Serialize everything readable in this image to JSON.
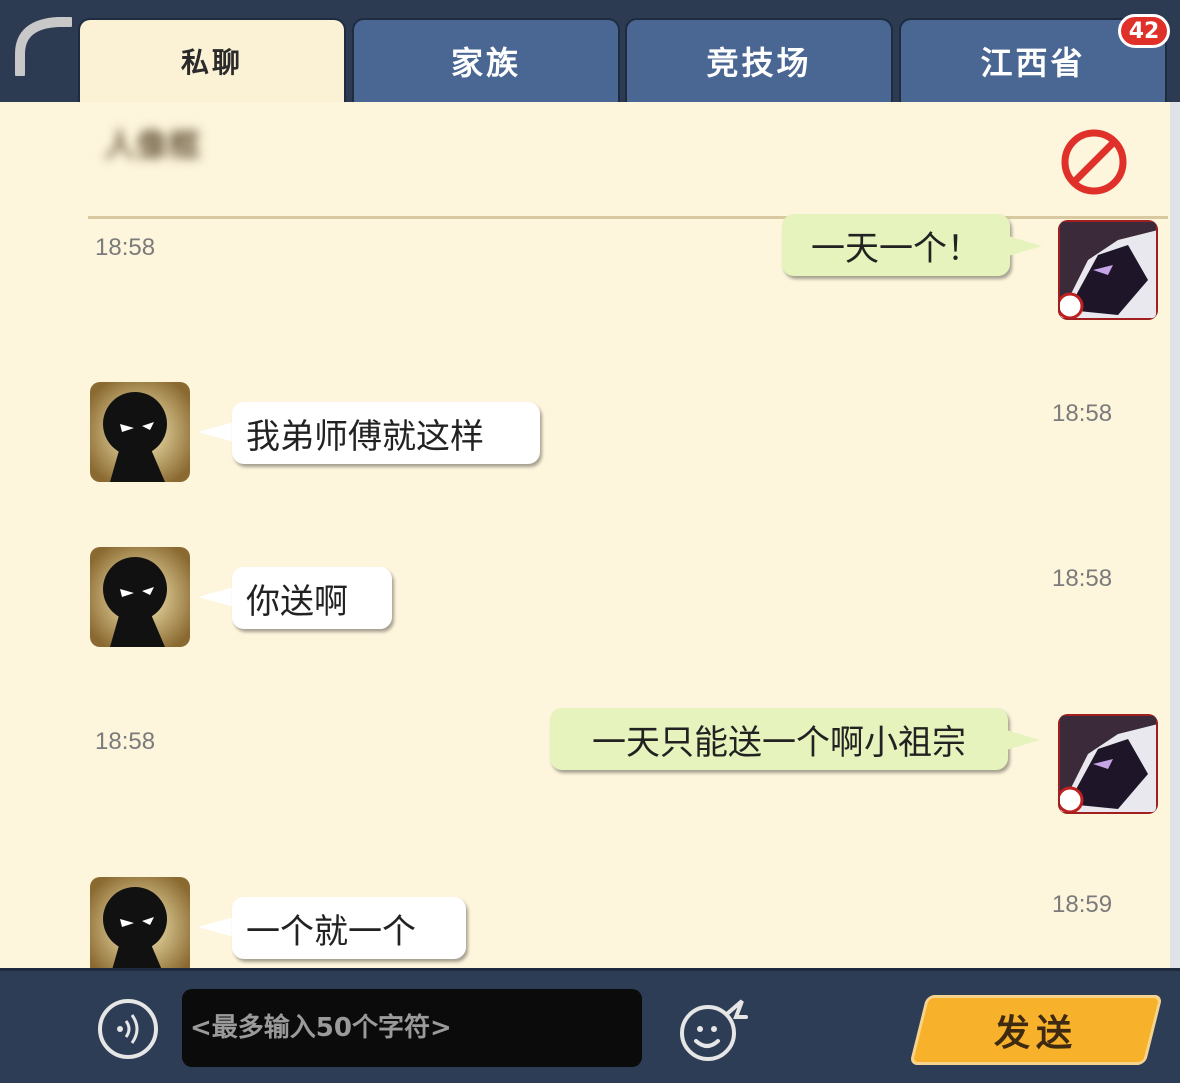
{
  "tabs": [
    {
      "label": "私聊"
    },
    {
      "label": "家族"
    },
    {
      "label": "竞技场"
    },
    {
      "label": "江西省"
    }
  ],
  "badge_count": "42",
  "header": {
    "contact_name": "人像框"
  },
  "messages": [
    {
      "side": "out",
      "text": "一天一个！",
      "time": "18:58"
    },
    {
      "side": "in",
      "text": "我弟师傅就这样",
      "time": "18:58"
    },
    {
      "side": "in",
      "text": "你送啊",
      "time": "18:58"
    },
    {
      "side": "out",
      "text": "一天只能送一个啊小祖宗",
      "time": "18:58"
    },
    {
      "side": "in",
      "text": "一个就一个",
      "time": "18:59"
    }
  ],
  "input": {
    "placeholder": "<最多输入50个字符>"
  },
  "send_button": {
    "label": "发送"
  },
  "icons": {
    "back": "back-arc-icon",
    "block": "block-icon",
    "voice": "voice-icon",
    "emoji": "emoji-icon"
  },
  "colors": {
    "tab_active": "#fbf2d6",
    "tab_inactive": "#4a6794",
    "panel_bg": "#fdf5dc",
    "bubble_out": "#e6f3bd",
    "bubble_in": "#ffffff",
    "send_button": "#f8b12a",
    "badge": "#e0302a",
    "block_icon": "#e0302a"
  }
}
